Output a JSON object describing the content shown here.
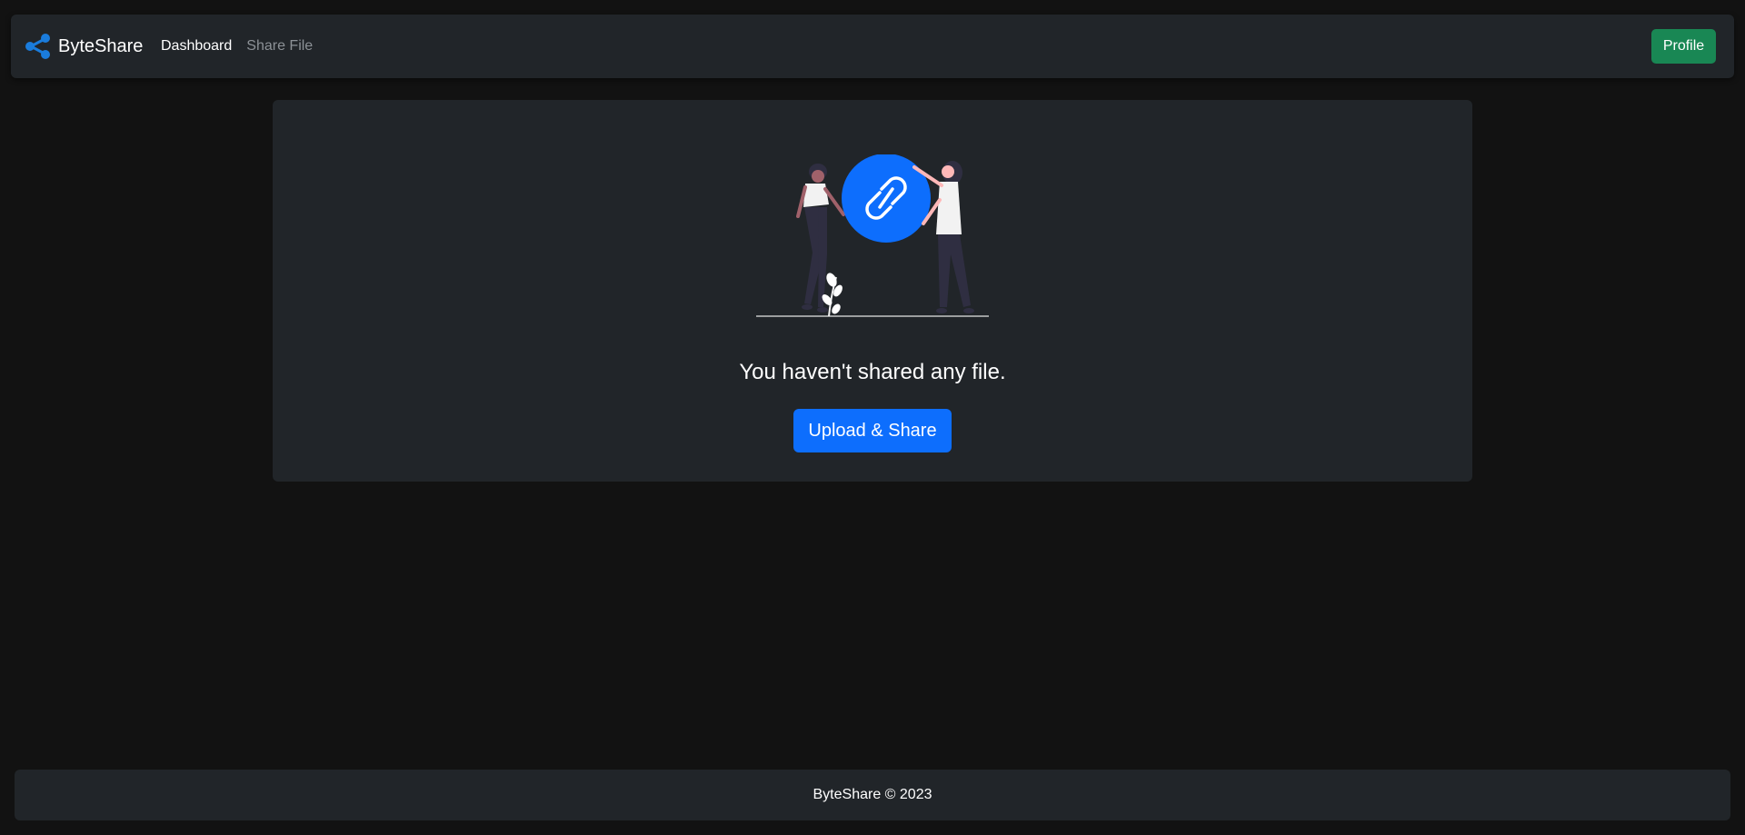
{
  "app": {
    "brand_name": "ByteShare",
    "brand_icon": "share-icon",
    "accent_color": "#0d6efd"
  },
  "nav": {
    "links": [
      {
        "label": "Dashboard",
        "active": true
      },
      {
        "label": "Share File",
        "active": false
      }
    ],
    "profile_label": "Profile",
    "profile_color": "#198754"
  },
  "main": {
    "illustration_icon": "link-icon",
    "empty_message": "You haven't shared any file.",
    "upload_label": "Upload & Share"
  },
  "footer": {
    "text": "ByteShare © 2023"
  }
}
